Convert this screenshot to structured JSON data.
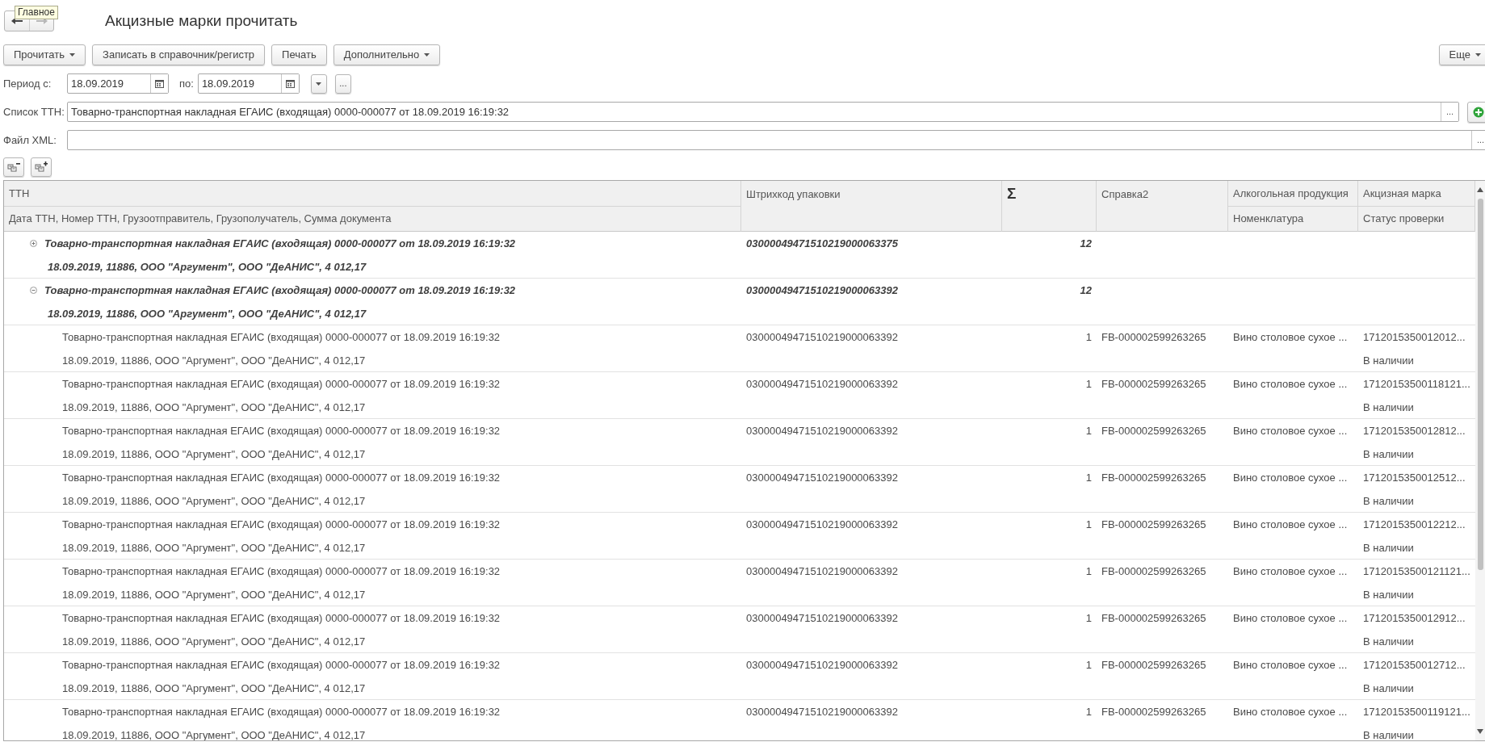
{
  "window": {
    "title": "Акцизные марки прочитать",
    "tooltip": "Главное"
  },
  "toolbar": {
    "buttons": [
      {
        "label": "Прочитать",
        "dropdown": true
      },
      {
        "label": "Записать в справочник/регистр",
        "dropdown": false
      },
      {
        "label": "Печать",
        "dropdown": false
      },
      {
        "label": "Дополнительно",
        "dropdown": true
      }
    ],
    "more": {
      "label": "Еще",
      "dropdown": true
    }
  },
  "period": {
    "label": "Период с:",
    "from": "18.09.2019",
    "to_label": "по:",
    "to": "18.09.2019",
    "choice_button": "..."
  },
  "ttn_list": {
    "label": "Список ТТН:",
    "value": "Товарно-транспортная накладная ЕГАИС (входящая) 0000-000077 от 18.09.2019 16:19:32",
    "choice_button": "..."
  },
  "xml_file": {
    "label": "Файл XML:",
    "choice_button": "..."
  },
  "table": {
    "columns": [
      {
        "title": "ТТН",
        "subtitle": "Дата ТТН, Номер ТТН, Грузоотправитель, Грузополучатель, Сумма документа"
      },
      {
        "title": "Штрихкод упаковки"
      },
      {
        "title": "Σ"
      },
      {
        "title": "Справка2"
      },
      {
        "title": "Алкогольная продукция",
        "subtitle": "Номенклатура"
      },
      {
        "title": "Акцизная марка",
        "subtitle": "Статус проверки"
      }
    ],
    "rows": [
      {
        "ttn": "Товарно-транспортная накладная ЕГАИС (входящая) 0000-000077 от 18.09.2019 16:19:32",
        "details": "18.09.2019, 11886, ООО \"Аргумент\", ООО \"ДеАНИС\", 4 012,17",
        "barcode": "03000049471510219000063375",
        "quantity": "12",
        "expanded": false
      },
      {
        "ttn": "Товарно-транспортная накладная ЕГАИС (входящая) 0000-000077 от 18.09.2019 16:19:32",
        "details": "18.09.2019, 11886, ООО \"Аргумент\", ООО \"ДеАНИС\", 4 012,17",
        "barcode": "03000049471510219000063392",
        "quantity": "12",
        "expanded": true,
        "children": [
          {
            "ttn": "Товарно-транспортная накладная ЕГАИС (входящая) 0000-000077 от 18.09.2019 16:19:32",
            "details": "18.09.2019, 11886, ООО \"Аргумент\", ООО \"ДеАНИС\", 4 012,17",
            "barcode": "03000049471510219000063392",
            "quantity": "1",
            "certificate": "FB-000002599263265",
            "product": "Вино столовое сухое ...",
            "mark": "1712015350012012...",
            "status": "В наличии"
          },
          {
            "ttn": "Товарно-транспортная накладная ЕГАИС (входящая) 0000-000077 от 18.09.2019 16:19:32",
            "details": "18.09.2019, 11886, ООО \"Аргумент\", ООО \"ДеАНИС\", 4 012,17",
            "barcode": "03000049471510219000063392",
            "quantity": "1",
            "certificate": "FB-000002599263265",
            "product": "Вино столовое сухое ...",
            "mark": "17120153500118121...",
            "status": "В наличии"
          },
          {
            "ttn": "Товарно-транспортная накладная ЕГАИС (входящая) 0000-000077 от 18.09.2019 16:19:32",
            "details": "18.09.2019, 11886, ООО \"Аргумент\", ООО \"ДеАНИС\", 4 012,17",
            "barcode": "03000049471510219000063392",
            "quantity": "1",
            "certificate": "FB-000002599263265",
            "product": "Вино столовое сухое ...",
            "mark": "1712015350012812...",
            "status": "В наличии"
          },
          {
            "ttn": "Товарно-транспортная накладная ЕГАИС (входящая) 0000-000077 от 18.09.2019 16:19:32",
            "details": "18.09.2019, 11886, ООО \"Аргумент\", ООО \"ДеАНИС\", 4 012,17",
            "barcode": "03000049471510219000063392",
            "quantity": "1",
            "certificate": "FB-000002599263265",
            "product": "Вино столовое сухое ...",
            "mark": "1712015350012512...",
            "status": "В наличии"
          },
          {
            "ttn": "Товарно-транспортная накладная ЕГАИС (входящая) 0000-000077 от 18.09.2019 16:19:32",
            "details": "18.09.2019, 11886, ООО \"Аргумент\", ООО \"ДеАНИС\", 4 012,17",
            "barcode": "03000049471510219000063392",
            "quantity": "1",
            "certificate": "FB-000002599263265",
            "product": "Вино столовое сухое ...",
            "mark": "1712015350012212...",
            "status": "В наличии"
          },
          {
            "ttn": "Товарно-транспортная накладная ЕГАИС (входящая) 0000-000077 от 18.09.2019 16:19:32",
            "details": "18.09.2019, 11886, ООО \"Аргумент\", ООО \"ДеАНИС\", 4 012,17",
            "barcode": "03000049471510219000063392",
            "quantity": "1",
            "certificate": "FB-000002599263265",
            "product": "Вино столовое сухое ...",
            "mark": "17120153500121121...",
            "status": "В наличии"
          },
          {
            "ttn": "Товарно-транспортная накладная ЕГАИС (входящая) 0000-000077 от 18.09.2019 16:19:32",
            "details": "18.09.2019, 11886, ООО \"Аргумент\", ООО \"ДеАНИС\", 4 012,17",
            "barcode": "03000049471510219000063392",
            "quantity": "1",
            "certificate": "FB-000002599263265",
            "product": "Вино столовое сухое ...",
            "mark": "1712015350012912...",
            "status": "В наличии"
          },
          {
            "ttn": "Товарно-транспортная накладная ЕГАИС (входящая) 0000-000077 от 18.09.2019 16:19:32",
            "details": "18.09.2019, 11886, ООО \"Аргумент\", ООО \"ДеАНИС\", 4 012,17",
            "barcode": "03000049471510219000063392",
            "quantity": "1",
            "certificate": "FB-000002599263265",
            "product": "Вино столовое сухое ...",
            "mark": "1712015350012712...",
            "status": "В наличии"
          },
          {
            "ttn": "Товарно-транспортная накладная ЕГАИС (входящая) 0000-000077 от 18.09.2019 16:19:32",
            "details": "18.09.2019, 11886, ООО \"Аргумент\", ООО \"ДеАНИС\", 4 012,17",
            "barcode": "03000049471510219000063392",
            "quantity": "1",
            "certificate": "FB-000002599263265",
            "product": "Вино столовое сухое ...",
            "mark": "17120153500119121...",
            "status": "В наличии"
          }
        ]
      }
    ]
  }
}
